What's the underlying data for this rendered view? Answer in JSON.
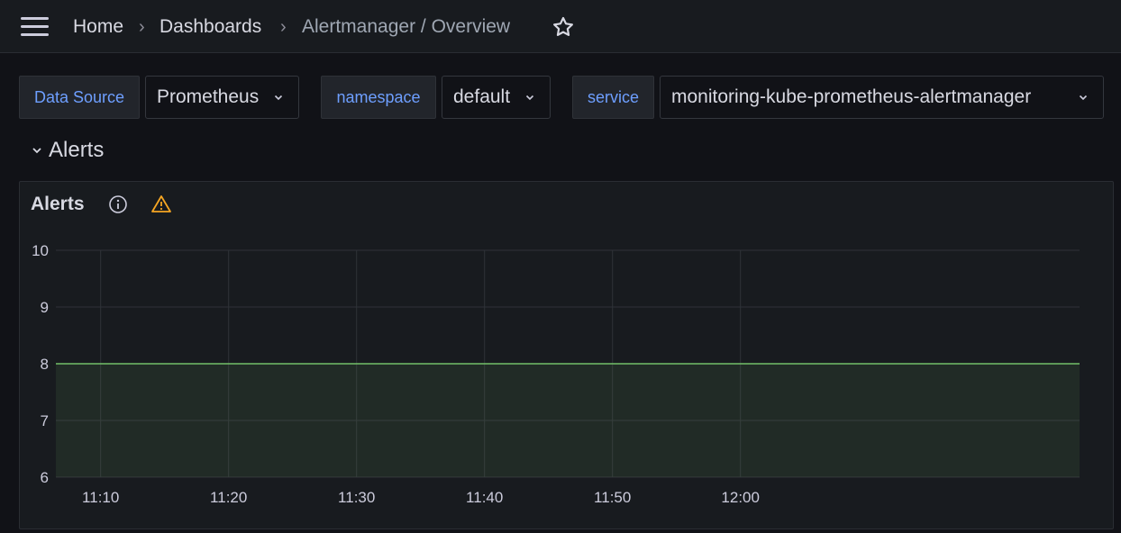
{
  "breadcrumb": {
    "items": [
      "Home",
      "Dashboards",
      "Alertmanager / Overview"
    ]
  },
  "variables": [
    {
      "label": "Data Source",
      "value": "Prometheus"
    },
    {
      "label": "namespace",
      "value": "default"
    },
    {
      "label": "service",
      "value": "monitoring-kube-prometheus-alertmanager"
    }
  ],
  "row": {
    "title": "Alerts"
  },
  "panel": {
    "title": "Alerts"
  },
  "colors": {
    "accent_link": "#6e9fff",
    "series_line": "#73bf69",
    "warning": "#f5a623"
  },
  "chart_data": {
    "type": "area",
    "x": [
      "11:10",
      "11:20",
      "11:30",
      "11:40",
      "11:50",
      "12:00"
    ],
    "x_range_minutes": [
      0,
      80
    ],
    "series": [
      {
        "points": [
          [
            0,
            8
          ],
          [
            80,
            8
          ]
        ]
      }
    ],
    "ylim": [
      6,
      10
    ],
    "yticks": [
      6,
      7,
      8,
      9,
      10
    ],
    "grid": true,
    "legend": "none"
  }
}
